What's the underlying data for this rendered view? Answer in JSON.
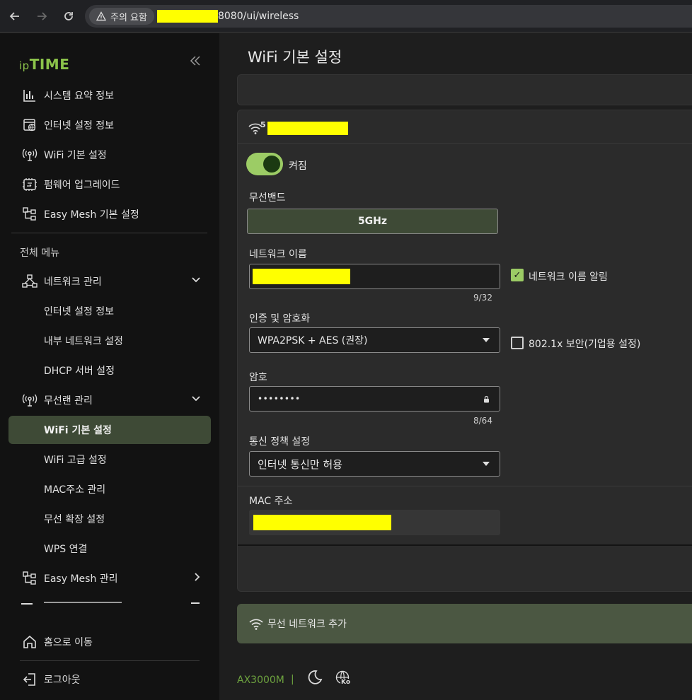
{
  "browser": {
    "warning_label": "주의 요함",
    "url_tail": "8080/ui/wireless"
  },
  "sidebar": {
    "logo_prefix": "ip",
    "logo_main": "TIME",
    "quick_items": [
      {
        "label": "시스템 요약 정보",
        "icon": "bar-chart-icon"
      },
      {
        "label": "인터넷 설정 정보",
        "icon": "globe-window-icon"
      },
      {
        "label": "WiFi 기본 설정",
        "icon": "wireless-tower-icon"
      },
      {
        "label": "펌웨어 업그레이드",
        "icon": "firmware-chip-icon"
      },
      {
        "label": "Easy Mesh 기본 설정",
        "icon": "mesh-tree-icon"
      }
    ],
    "all_menu_label": "전체 메뉴",
    "network_group": {
      "label": "네트워크 관리",
      "children": [
        "인터넷 설정 정보",
        "내부 네트워크 설정",
        "DHCP 서버 설정"
      ]
    },
    "wireless_group": {
      "label": "무선랜 관리",
      "children": [
        "WiFi 기본 설정",
        "WiFi 고급 설정",
        "MAC주소 관리",
        "무선 확장 설정",
        "WPS 연결"
      ]
    },
    "easymesh_group": {
      "label": "Easy Mesh 관리"
    },
    "home_label": "홈으로 이동",
    "logout_label": "로그아웃"
  },
  "main": {
    "title": "WiFi 기본 설정",
    "band_superscript": "5",
    "toggle_label": "켜짐",
    "band": {
      "label": "무선밴드",
      "value": "5GHz"
    },
    "network_name": {
      "label": "네트워크 이름",
      "counter": "9/32",
      "broadcast_label": "네트워크 이름 알림"
    },
    "auth": {
      "label": "인증 및 암호화",
      "value": "WPA2PSK + AES (권장)",
      "enterprise_label": "802.1x 보안(기업용 설정)"
    },
    "password": {
      "label": "암호",
      "value": "••••••••",
      "counter": "8/64"
    },
    "policy": {
      "label": "통신 정책 설정",
      "value": "인터넷 통신만 허용"
    },
    "mac": {
      "label": "MAC 주소"
    },
    "add_network_label": "무선 네트워크 추가"
  },
  "footer": {
    "model": "AX3000M",
    "separator": "|",
    "lang_badge": "Ko"
  },
  "colors": {
    "accent_green": "#9ccc65",
    "active_bg": "#3e4a36",
    "add_bar_bg": "#4b5742",
    "redaction": "#ffff00"
  }
}
